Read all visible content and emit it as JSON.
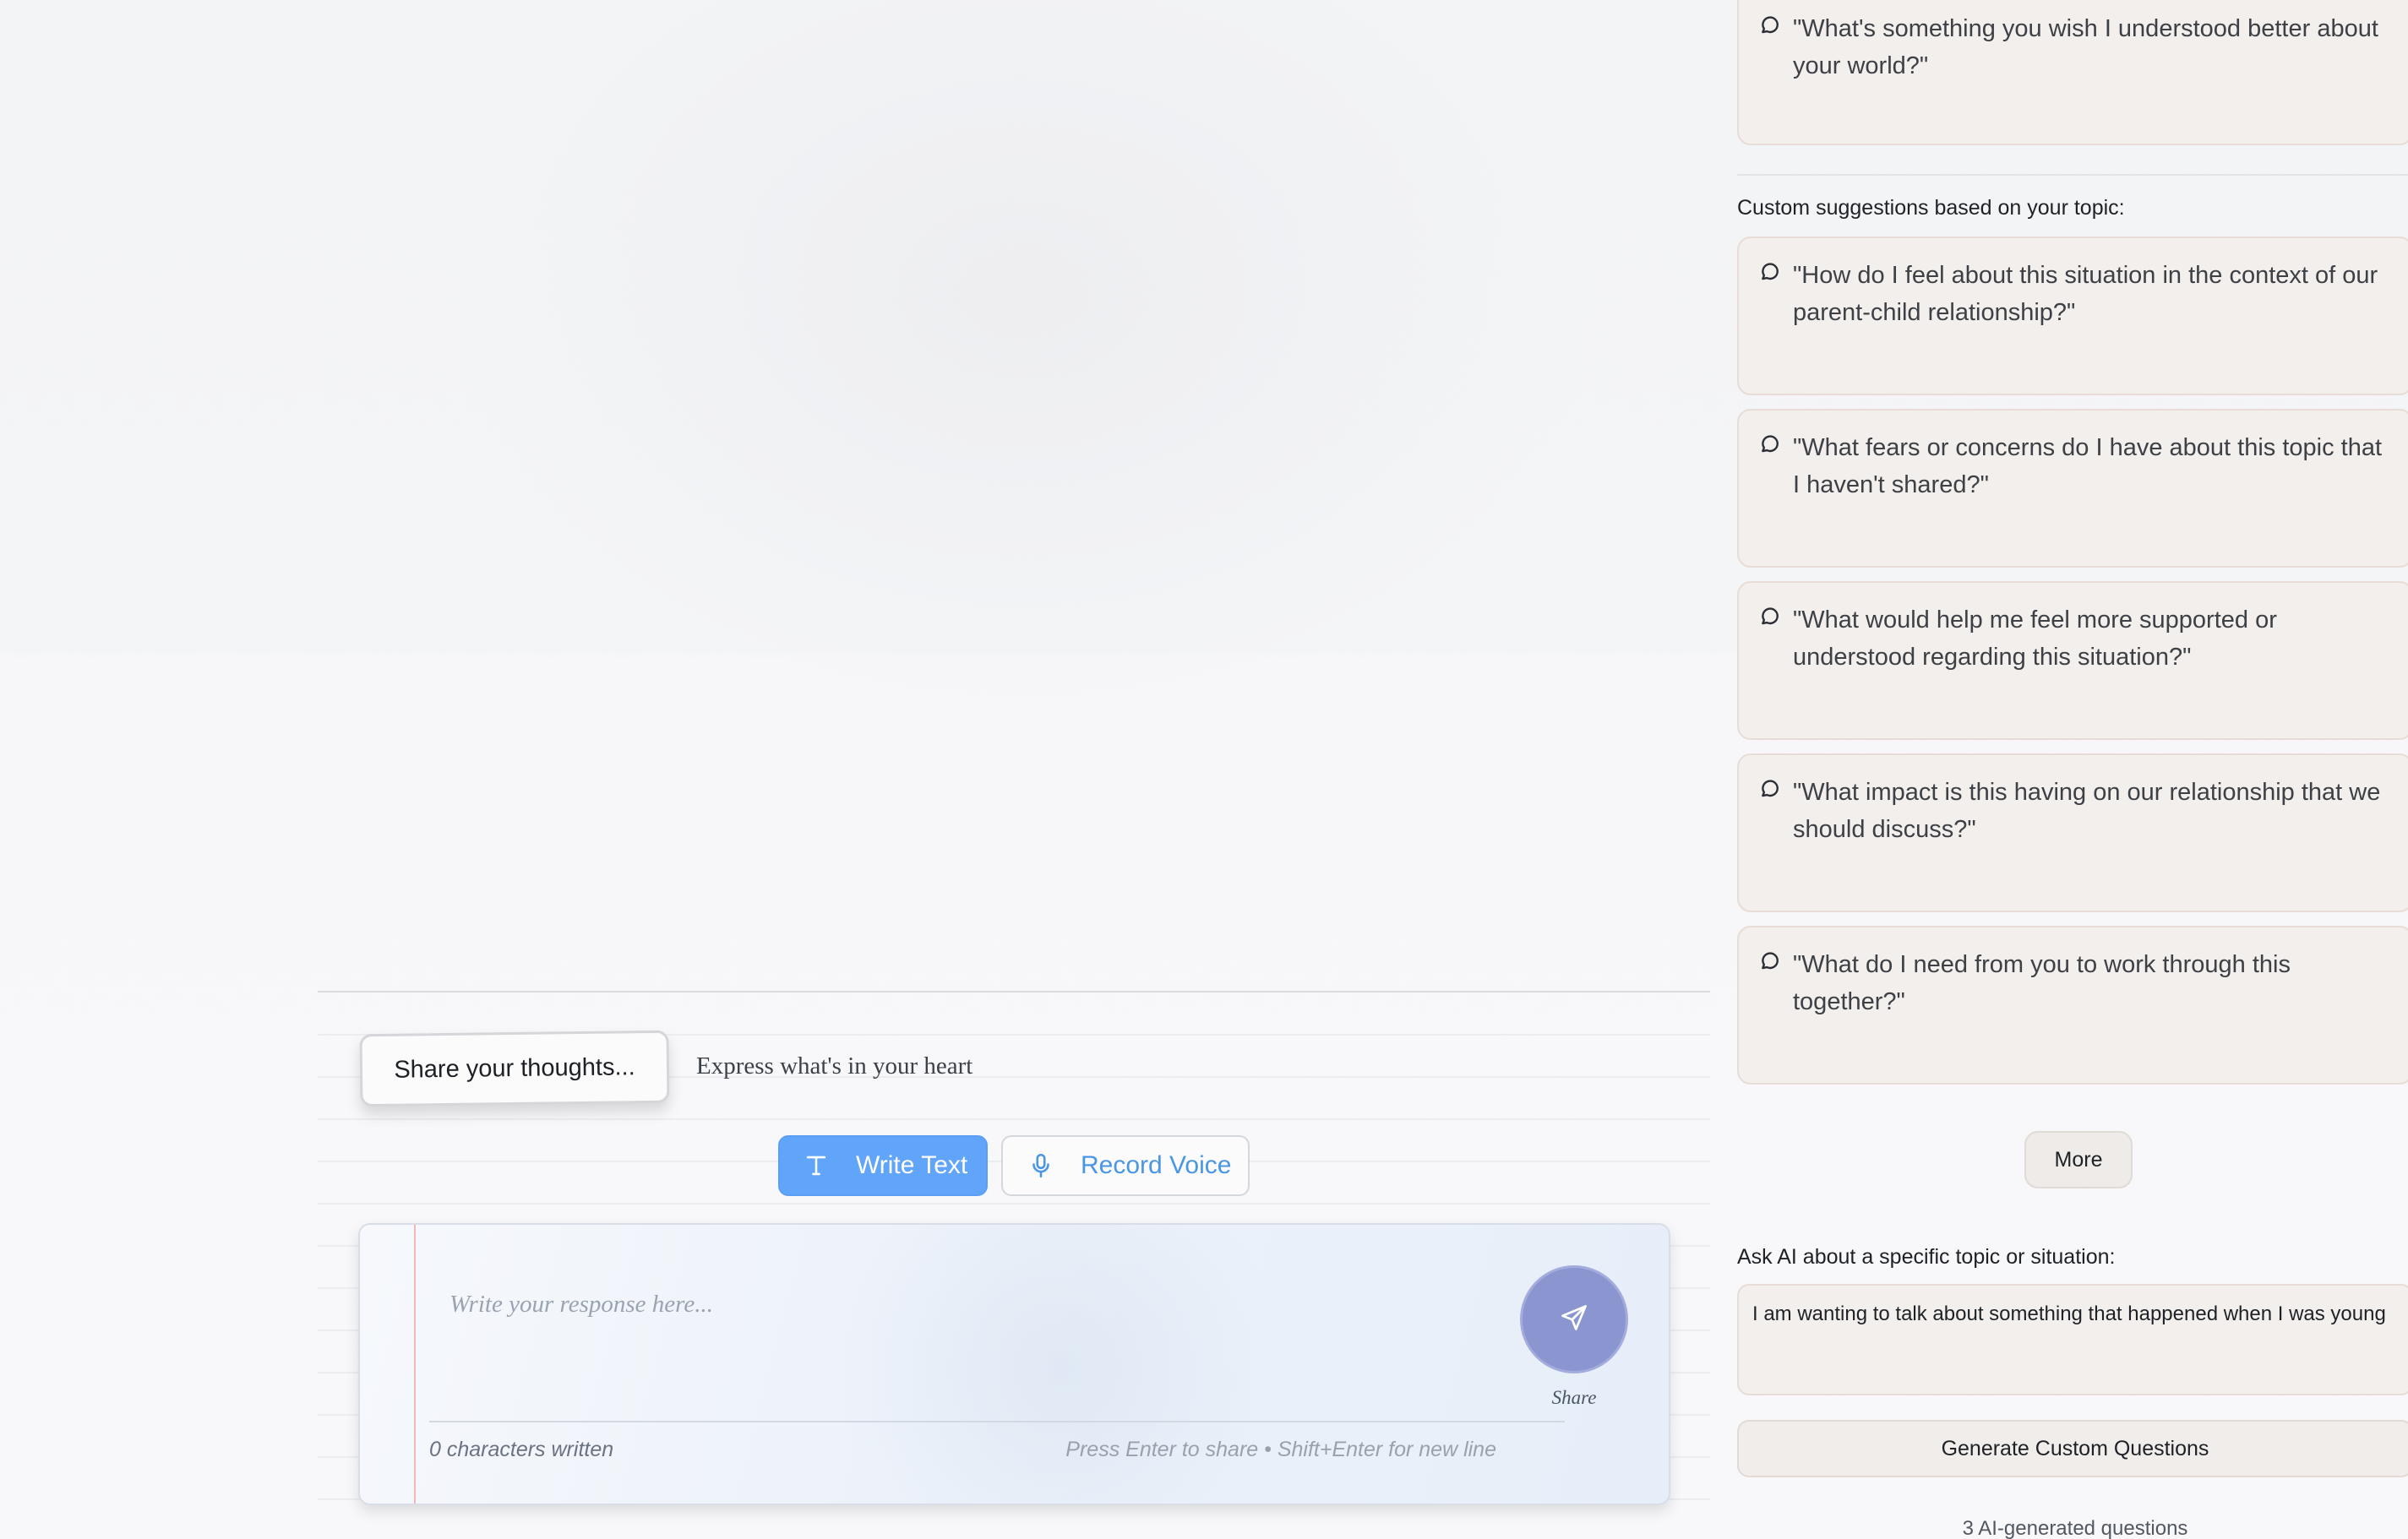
{
  "composer": {
    "prompt_chip": "Share your thoughts...",
    "prompt_subtitle": "Express what's in your heart",
    "modes": [
      {
        "label": "Write Text",
        "icon": "text-icon",
        "active": true
      },
      {
        "label": "Record Voice",
        "icon": "microphone-icon",
        "active": false
      }
    ],
    "placeholder": "Write your response here...",
    "char_count": "0 characters written",
    "hint": "Press Enter to share • Shift+Enter for new line",
    "send_label": "Share",
    "send_icon": "send-icon"
  },
  "sidebar": {
    "top_question": "\"What's something you wish I understood better about your world?\"",
    "custom_heading": "Custom suggestions based on your topic:",
    "custom_questions": [
      "\"How do I feel about this situation in the context of our parent-child relationship?\"",
      "\"What fears or concerns do I have about this topic that I haven't shared?\"",
      "\"What would help me feel more supported or understood regarding this situation?\"",
      "\"What impact is this having on our relationship that we should discuss?\"",
      "\"What do I need from you to work through this together?\""
    ],
    "more_label": "More",
    "ask_heading": "Ask AI about a specific topic or situation:",
    "topic_value": "I am wanting to talk about something that happened when I was young",
    "generate_label": "Generate Custom Questions",
    "ai_count": "3 AI-generated questions"
  },
  "colors": {
    "accent_blue": "#60a5fa",
    "voice_blue": "#4a96e6",
    "send_purple": "#8b96d0",
    "card_bg": "#f3efed",
    "card_border": "#e8dcd6",
    "margin_red": "#f0b9b9"
  }
}
